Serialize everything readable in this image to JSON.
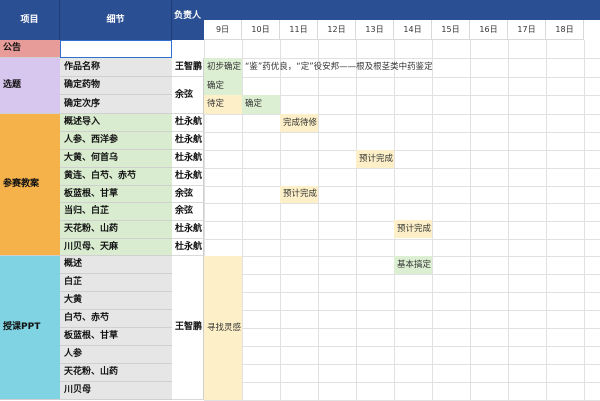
{
  "header": {
    "col_project": "项目",
    "col_detail": "细节",
    "col_owner": "负责人",
    "days": [
      "9日",
      "10日",
      "11日",
      "12日",
      "13日",
      "14日",
      "15日",
      "16日",
      "17日",
      "18日"
    ]
  },
  "sections": [
    {
      "name": "公告",
      "color": "#e89c9a"
    },
    {
      "name": "选题",
      "color": "#d7c6ee"
    },
    {
      "name": "参赛教案",
      "color": "#f6b24a"
    },
    {
      "name": "授课PPT",
      "color": "#7fd3e2"
    }
  ],
  "items": {
    "topic": [
      "作品名称",
      "确定药物",
      "确定次序"
    ],
    "lesson": [
      "概述导入",
      "人参、西洋参",
      "大黄、何首乌",
      "黄连、白芍、赤芍",
      "板蓝根、甘草",
      "当归、白芷",
      "天花粉、山药",
      "川贝母、天麻"
    ],
    "ppt": [
      "概述",
      "白芷",
      "大黄",
      "白芍、赤芍",
      "板蓝根、甘草",
      "人参",
      "天花粉、山药",
      "川贝母"
    ]
  },
  "owners": {
    "topic": [
      "王智鹏",
      "余弦"
    ],
    "lesson": [
      "杜永航",
      "杜永航",
      "杜永航",
      "杜永航",
      "余弦",
      "余弦",
      "杜永航",
      "杜永航"
    ],
    "ppt": "王智鹏"
  },
  "tasks": {
    "topic_name": "初步确定",
    "topic_name_note": "“鉴”药优良，“定”役安邦——根及根茎类中药鉴定",
    "drug_confirm": "确定",
    "order_pending": "待定",
    "order_confirm": "确定",
    "lesson_intro": "完成待修",
    "lesson_coptis": "预计完成",
    "lesson_isatis": "预计完成",
    "lesson_trichosanthes": "预计完成",
    "ppt_overview": "基本搞定",
    "ppt_inspiration": "寻找灵感"
  },
  "colors": {
    "header_bg": "#2b4f93",
    "item_lesson_bg": "#d9ecd0",
    "item_default_bg": "#e6e6e6",
    "task_yellow": "#fdf0c8",
    "task_green": "#dcefd3"
  }
}
